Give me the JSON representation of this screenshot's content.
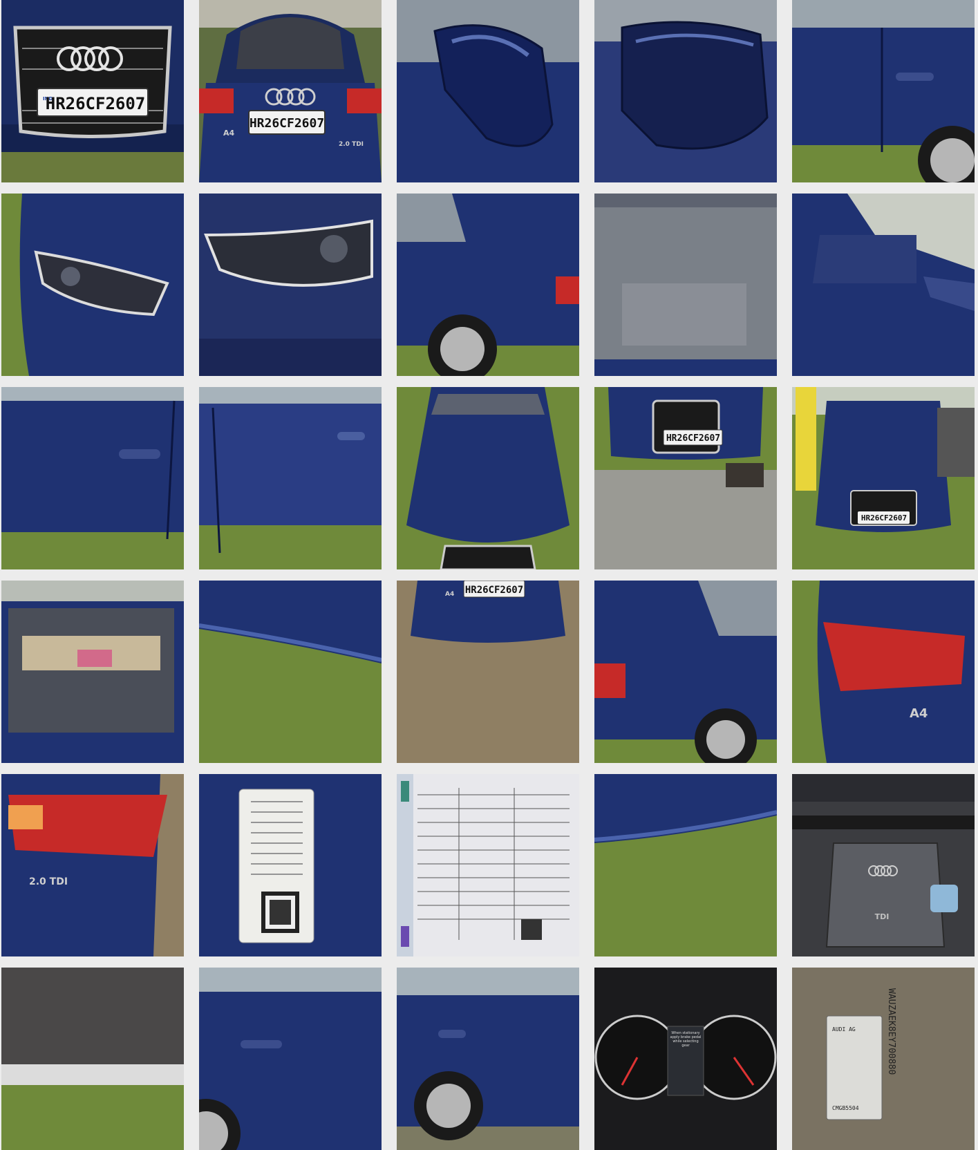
{
  "gallery": {
    "plate": "HR26CF2607",
    "plate_country": "IND",
    "model_badge": "A4",
    "engine_badge": "2.0 TDI",
    "engine_cover_label": "TDI",
    "vin": "WAUZAEK8EY700880",
    "label_maker": "AUDI AG",
    "label_code": "CMGB5504",
    "cluster_message": "When stationary apply brake pedal while selecting gear",
    "colors": {
      "body_blue": "#1f3272",
      "grass": "#6f8a3a",
      "concrete": "#9a9a94",
      "taillight": "#c62a28",
      "background": "#ececec"
    }
  }
}
